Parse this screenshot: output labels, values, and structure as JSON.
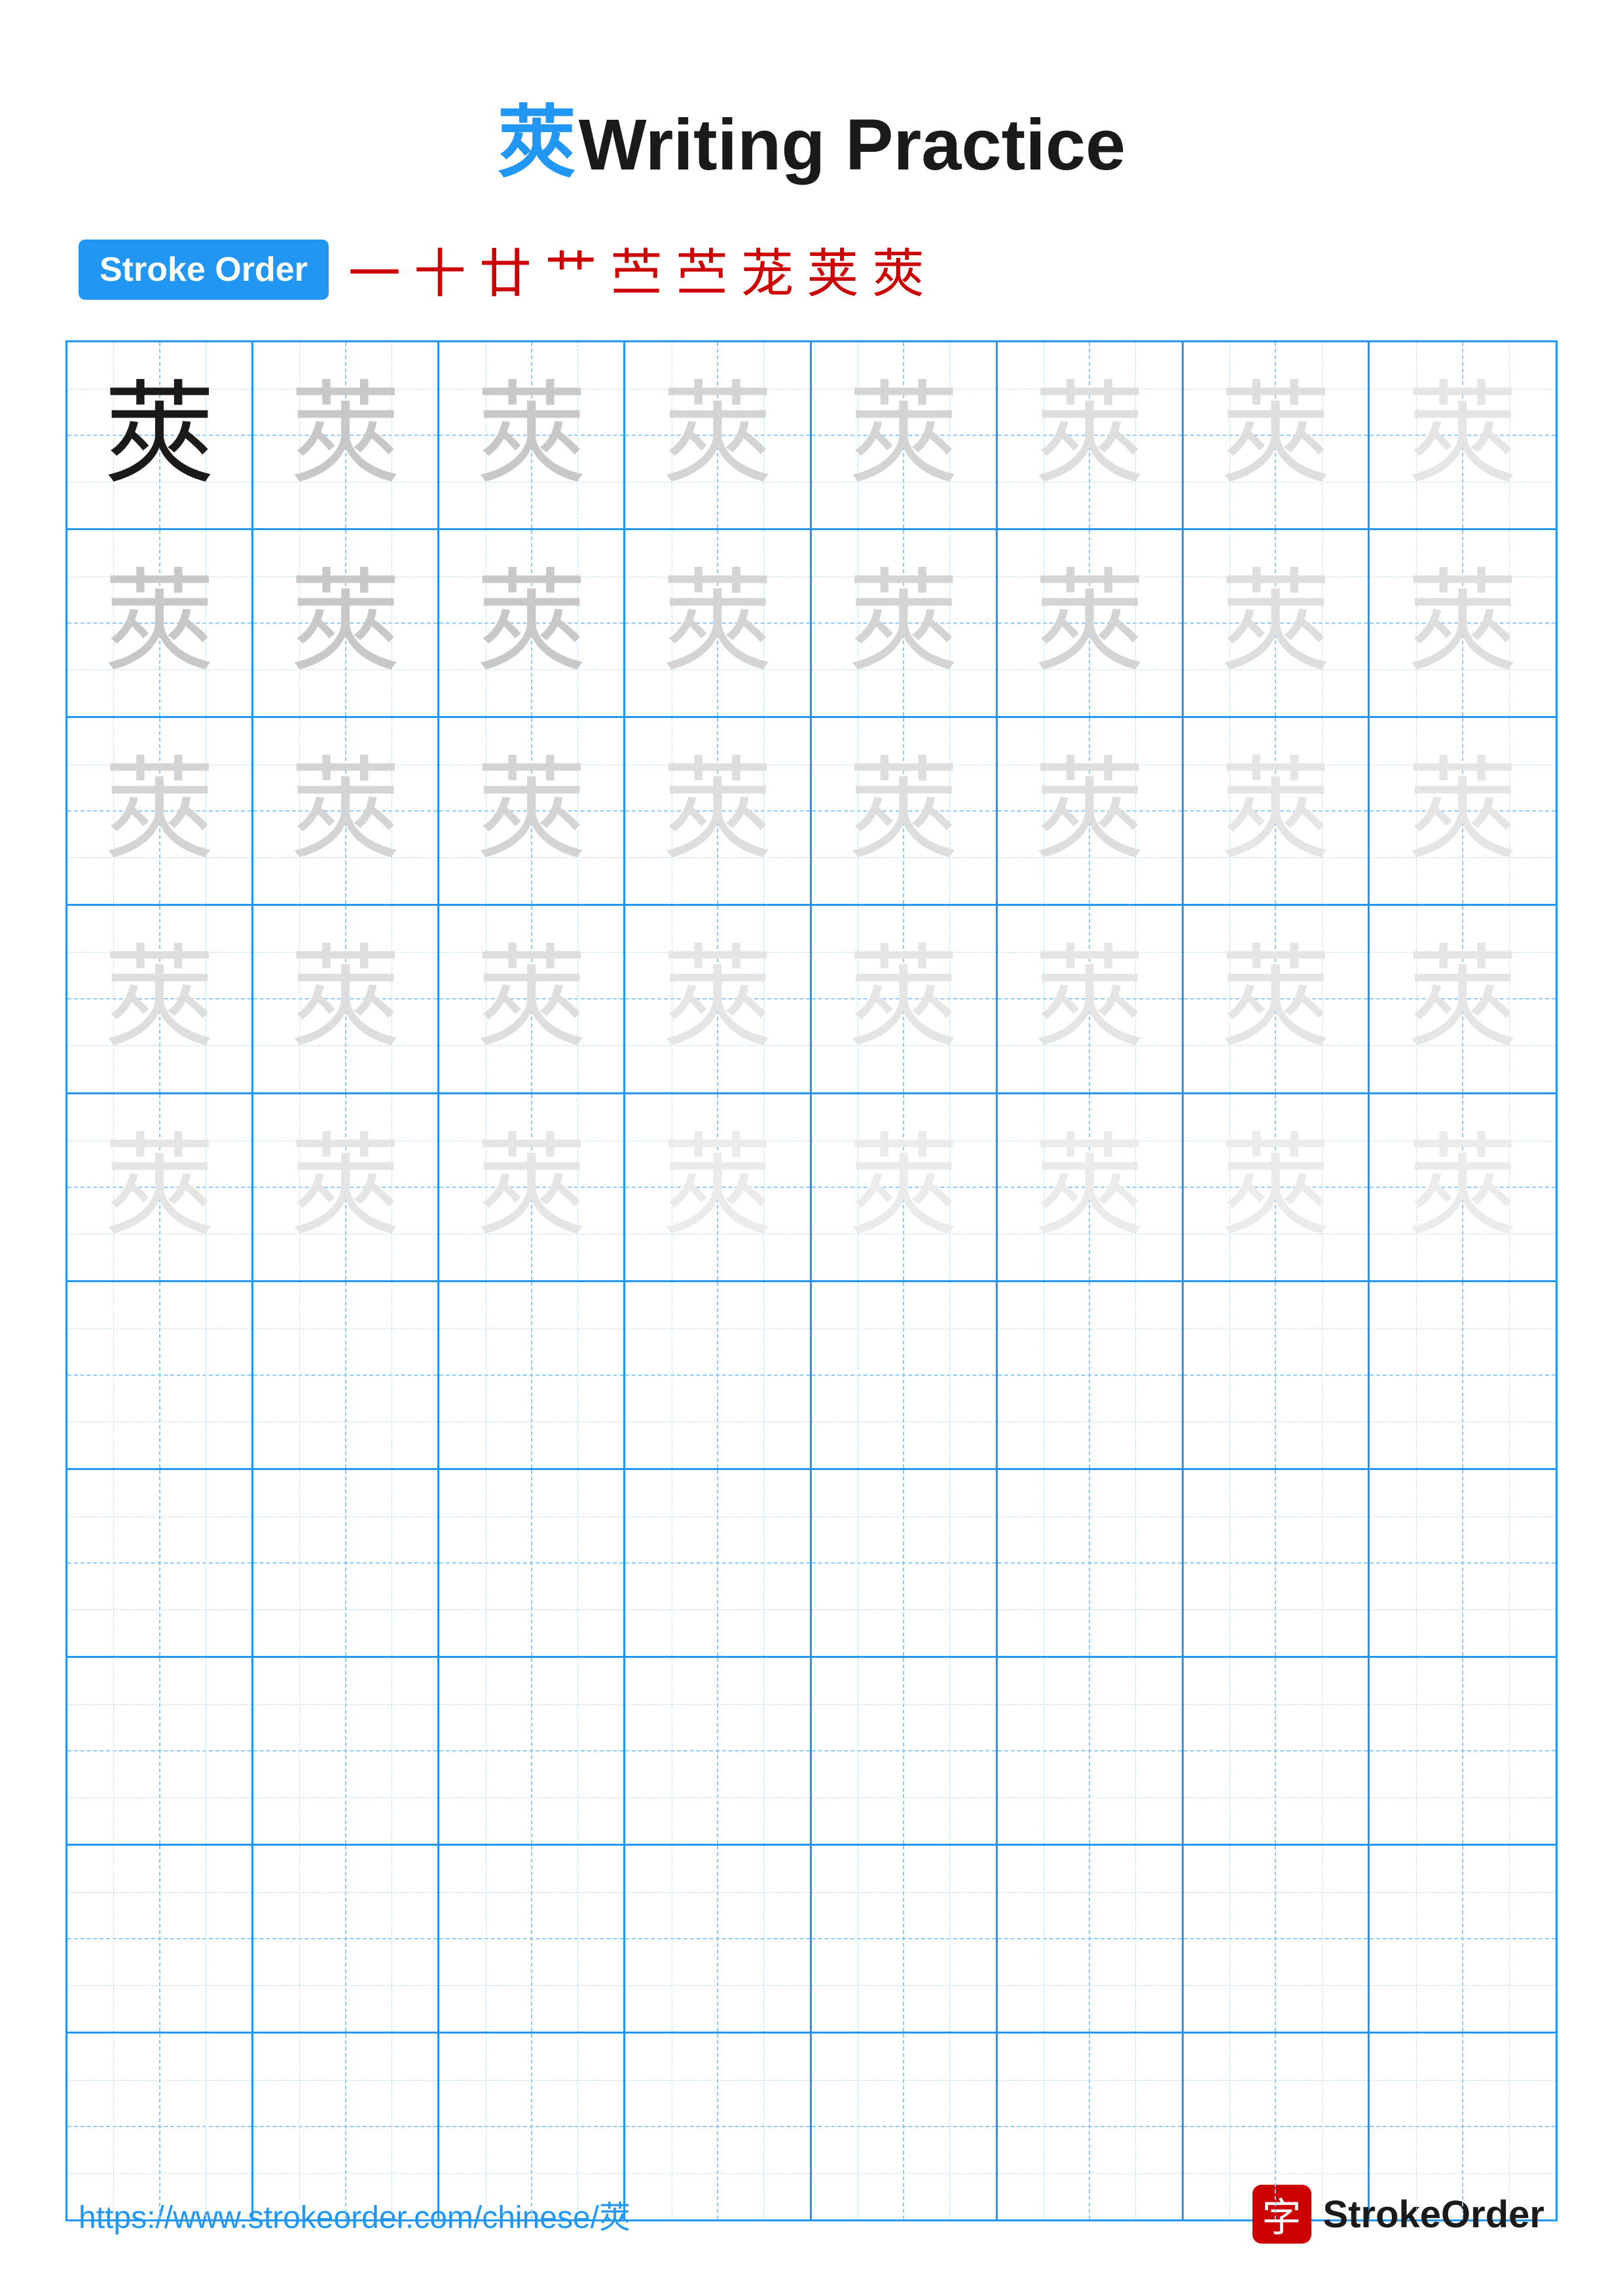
{
  "title": {
    "char": "莢",
    "label": "Writing Practice"
  },
  "stroke_order": {
    "badge": "Stroke Order",
    "chars": [
      "一",
      "十",
      "廿",
      "艹",
      "苎",
      "苎",
      "茏",
      "荚",
      "莢"
    ]
  },
  "grid": {
    "cols": 8,
    "practice_char": "莢",
    "rows": [
      {
        "cells": [
          {
            "type": "dark"
          },
          {
            "type": "light1"
          },
          {
            "type": "light1"
          },
          {
            "type": "light2"
          },
          {
            "type": "light2"
          },
          {
            "type": "light3"
          },
          {
            "type": "light3"
          },
          {
            "type": "light4"
          }
        ]
      },
      {
        "cells": [
          {
            "type": "light1"
          },
          {
            "type": "light1"
          },
          {
            "type": "light1"
          },
          {
            "type": "light2"
          },
          {
            "type": "light2"
          },
          {
            "type": "light2"
          },
          {
            "type": "light3"
          },
          {
            "type": "light3"
          }
        ]
      },
      {
        "cells": [
          {
            "type": "light2"
          },
          {
            "type": "light2"
          },
          {
            "type": "light2"
          },
          {
            "type": "light3"
          },
          {
            "type": "light3"
          },
          {
            "type": "light3"
          },
          {
            "type": "light4"
          },
          {
            "type": "light4"
          }
        ]
      },
      {
        "cells": [
          {
            "type": "light3"
          },
          {
            "type": "light3"
          },
          {
            "type": "light3"
          },
          {
            "type": "light4"
          },
          {
            "type": "light4"
          },
          {
            "type": "light4"
          },
          {
            "type": "light4"
          },
          {
            "type": "light4"
          }
        ]
      },
      {
        "cells": [
          {
            "type": "light4"
          },
          {
            "type": "light4"
          },
          {
            "type": "light4"
          },
          {
            "type": "light5"
          },
          {
            "type": "light5"
          },
          {
            "type": "light5"
          },
          {
            "type": "light5"
          },
          {
            "type": "light5"
          }
        ]
      },
      {
        "cells": [
          {
            "type": "empty"
          },
          {
            "type": "empty"
          },
          {
            "type": "empty"
          },
          {
            "type": "empty"
          },
          {
            "type": "empty"
          },
          {
            "type": "empty"
          },
          {
            "type": "empty"
          },
          {
            "type": "empty"
          }
        ]
      },
      {
        "cells": [
          {
            "type": "empty"
          },
          {
            "type": "empty"
          },
          {
            "type": "empty"
          },
          {
            "type": "empty"
          },
          {
            "type": "empty"
          },
          {
            "type": "empty"
          },
          {
            "type": "empty"
          },
          {
            "type": "empty"
          }
        ]
      },
      {
        "cells": [
          {
            "type": "empty"
          },
          {
            "type": "empty"
          },
          {
            "type": "empty"
          },
          {
            "type": "empty"
          },
          {
            "type": "empty"
          },
          {
            "type": "empty"
          },
          {
            "type": "empty"
          },
          {
            "type": "empty"
          }
        ]
      },
      {
        "cells": [
          {
            "type": "empty"
          },
          {
            "type": "empty"
          },
          {
            "type": "empty"
          },
          {
            "type": "empty"
          },
          {
            "type": "empty"
          },
          {
            "type": "empty"
          },
          {
            "type": "empty"
          },
          {
            "type": "empty"
          }
        ]
      },
      {
        "cells": [
          {
            "type": "empty"
          },
          {
            "type": "empty"
          },
          {
            "type": "empty"
          },
          {
            "type": "empty"
          },
          {
            "type": "empty"
          },
          {
            "type": "empty"
          },
          {
            "type": "empty"
          },
          {
            "type": "empty"
          }
        ]
      }
    ]
  },
  "footer": {
    "url": "https://www.strokeorder.com/chinese/莢",
    "brand_icon": "字",
    "brand_name": "StrokeOrder"
  }
}
